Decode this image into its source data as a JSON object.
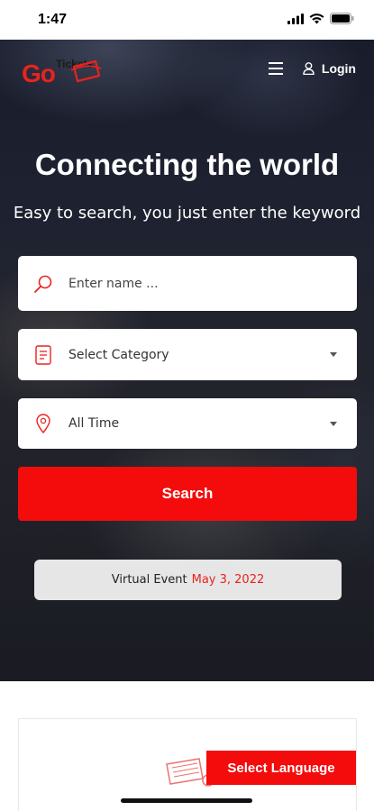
{
  "status_bar": {
    "time": "1:47"
  },
  "header": {
    "logo": {
      "primary": "Go",
      "secondary": "Tickets"
    },
    "login_label": "Login"
  },
  "hero": {
    "title": "Connecting the world",
    "subtitle": "Easy to search, you just enter the keyword"
  },
  "search_form": {
    "name_placeholder": "Enter name ...",
    "category_value": "Select Category",
    "time_value": "All Time",
    "search_label": "Search"
  },
  "event": {
    "label": "Virtual Event",
    "date": "May 3, 2022"
  },
  "language_button": "Select Language",
  "colors": {
    "accent": "#f40b0b",
    "hero_dark": "#1f2128",
    "pill": "#e6e6e6"
  },
  "icons": [
    "signal-icon",
    "wifi-icon",
    "battery-icon",
    "menu-icon",
    "user-icon",
    "search-icon",
    "document-icon",
    "location-pin-icon",
    "chevron-down-icon",
    "ticket-icon"
  ]
}
